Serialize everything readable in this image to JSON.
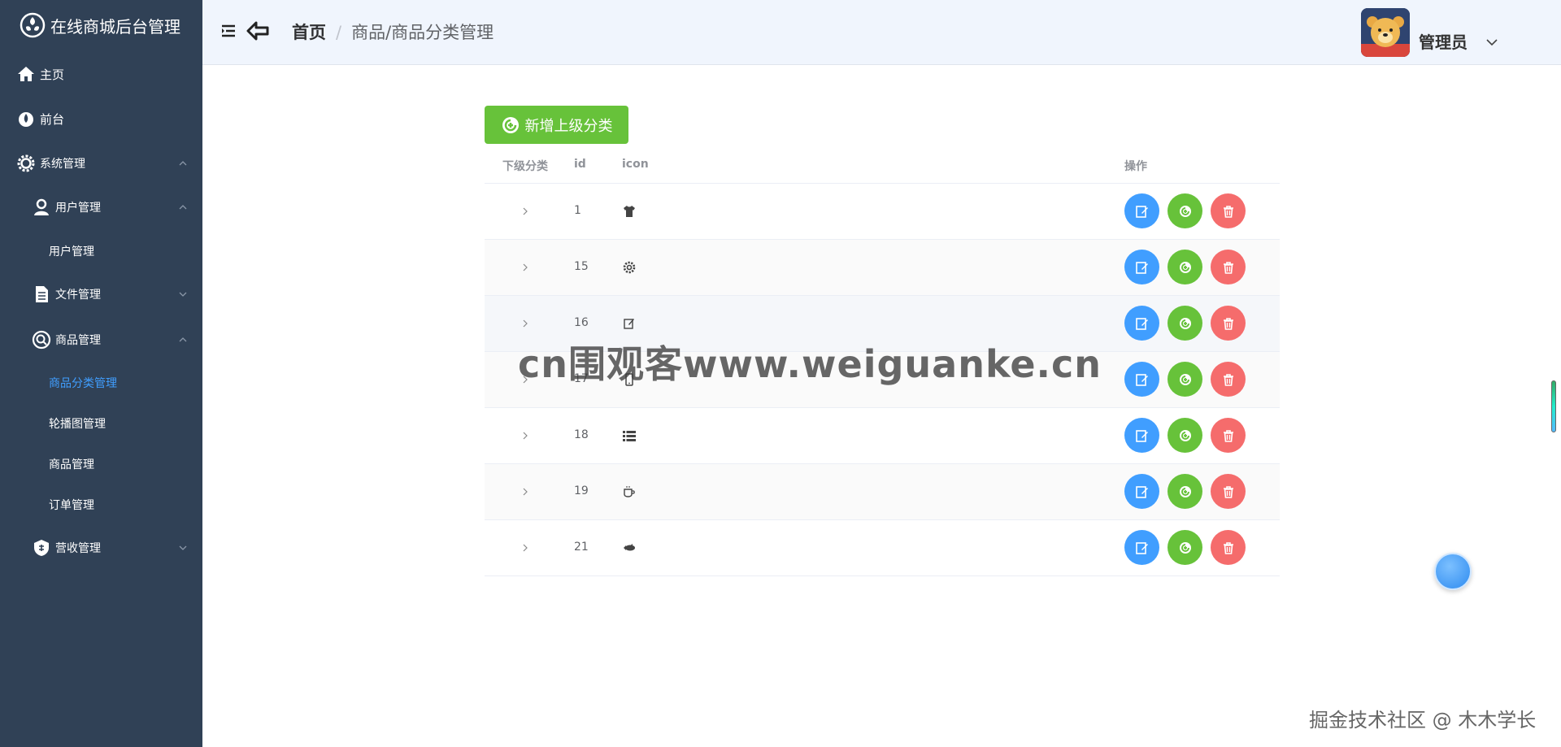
{
  "app": {
    "title": "在线商城后台管理"
  },
  "sidebar": {
    "items": [
      {
        "label": "主页",
        "icon": "home-icon"
      },
      {
        "label": "前台",
        "icon": "drop-icon"
      },
      {
        "label": "系统管理",
        "icon": "gear-icon"
      },
      {
        "label": "用户管理",
        "icon": "user-icon"
      },
      {
        "label": "用户管理"
      },
      {
        "label": "文件管理",
        "icon": "file-icon"
      },
      {
        "label": "商品管理",
        "icon": "search-icon"
      },
      {
        "label": "商品分类管理",
        "active": true
      },
      {
        "label": "轮播图管理"
      },
      {
        "label": "商品管理"
      },
      {
        "label": "订单管理"
      },
      {
        "label": "营收管理",
        "icon": "shield-icon"
      }
    ]
  },
  "header": {
    "breadcrumb_home": "首页",
    "breadcrumb_sep": "/",
    "breadcrumb_current": "商品/商品分类管理",
    "user_name": "管理员"
  },
  "main": {
    "add_button_label": "新增上级分类",
    "columns": {
      "expand": "下级分类",
      "id": "id",
      "icon": "icon",
      "ops": "操作"
    },
    "rows": [
      {
        "id": "1",
        "icon": "tshirt-icon"
      },
      {
        "id": "15",
        "icon": "gear-icon"
      },
      {
        "id": "16",
        "icon": "edit-icon"
      },
      {
        "id": "17",
        "icon": "mobile-icon"
      },
      {
        "id": "18",
        "icon": "list-icon"
      },
      {
        "id": "19",
        "icon": "coffee-icon"
      },
      {
        "id": "21",
        "icon": "fish-icon"
      }
    ]
  },
  "overlay": {
    "watermark": "cn围观客www.weiguanke.cn",
    "credit": "掘金技术社区 @ 木木学长"
  },
  "colors": {
    "sidebar_bg": "#304156",
    "header_bg": "#f0f5fd",
    "primary": "#409eff",
    "success": "#67c23a",
    "danger": "#f56c6c",
    "active_menu": "#409eff"
  }
}
